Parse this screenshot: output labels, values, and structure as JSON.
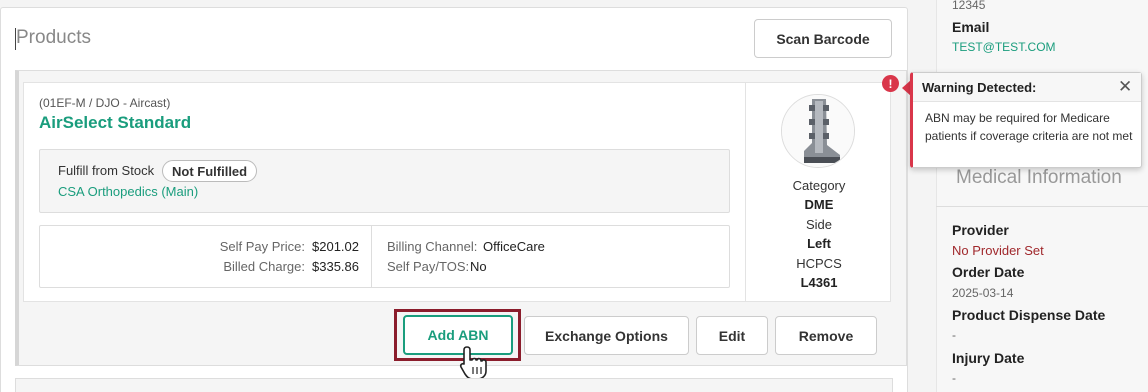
{
  "products": {
    "title": "Products",
    "scan_barcode": "Scan Barcode"
  },
  "item": {
    "sku": "(01EF-M / DJO - Aircast)",
    "name": "AirSelect Standard",
    "fulfill_label": "Fulfill from Stock",
    "fulfill_status": "Not Fulfilled",
    "location": "CSA Orthopedics (Main)",
    "self_pay_label": "Self Pay Price:",
    "self_pay_value": "$201.02",
    "billed_label": "Billed Charge:",
    "billed_value": "$335.86",
    "billing_channel_label": "Billing Channel:",
    "billing_channel_value": "OfficeCare",
    "self_pay_tos_label": "Self Pay/TOS:",
    "self_pay_tos_value": "No",
    "category_label": "Category",
    "category_value": "DME",
    "side_label": "Side",
    "side_value": "Left",
    "hcpcs_label": "HCPCS",
    "hcpcs_value": "L4361"
  },
  "actions": {
    "add_abn": "Add ABN",
    "exchange": "Exchange Options",
    "edit": "Edit",
    "remove": "Remove"
  },
  "sidebar": {
    "zip": "12345",
    "email_label": "Email",
    "email_value": "TEST@TEST.COM",
    "medical_title": "Medical Information",
    "provider_label": "Provider",
    "provider_value": "No Provider Set",
    "order_date_label": "Order Date",
    "order_date_value": "2025-03-14",
    "dispense_label": "Product Dispense Date",
    "dispense_value": "-",
    "injury_label": "Injury Date",
    "injury_value": "-"
  },
  "warning": {
    "icon": "!",
    "title": "Warning Detected:",
    "close": "✕",
    "message": "ABN may be required for Medicare patients if coverage criteria are not met"
  },
  "colors": {
    "accent": "#1a9d7d",
    "warning": "#d9364a",
    "highlight": "#8b1d2c"
  }
}
